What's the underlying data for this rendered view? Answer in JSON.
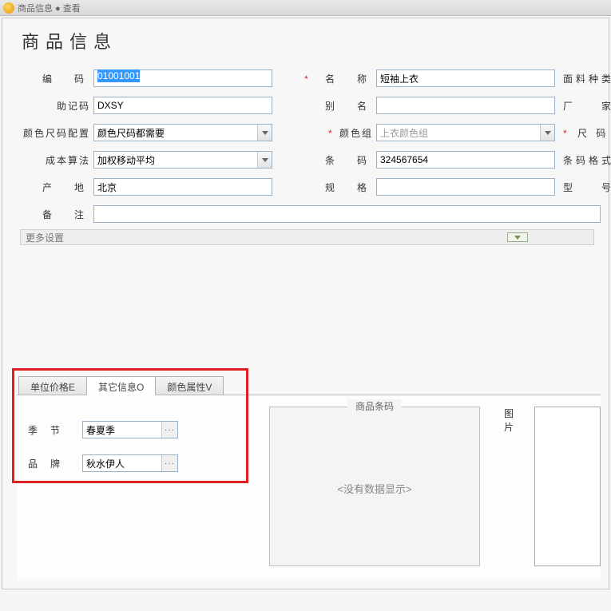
{
  "titlebar": {
    "text": "商品信息 ● 查看"
  },
  "page_title": "商品信息",
  "form": {
    "code": {
      "label": "编　码",
      "value": "01001001"
    },
    "mnemonic": {
      "label": "助记码",
      "value": "DXSY"
    },
    "colorsize": {
      "label": "颜色尺码配置",
      "value": "颜色尺码都需要"
    },
    "costmethod": {
      "label": "成本算法",
      "value": "加权移动平均"
    },
    "origin": {
      "label": "产　地",
      "value": "北京"
    },
    "remarks": {
      "label": "备　注",
      "value": ""
    },
    "name": {
      "label": "名　称",
      "value": "短袖上衣"
    },
    "alias": {
      "label": "别　名",
      "value": ""
    },
    "colorgroup": {
      "label": "颜色组",
      "value": "上衣颜色组"
    },
    "barcode": {
      "label": "条　码",
      "value": "324567654"
    },
    "spec": {
      "label": "规　格",
      "value": ""
    },
    "fabric": {
      "label": "面料种类"
    },
    "factory": {
      "label": "厂　　家"
    },
    "sizegroup": {
      "label": "尺 码 组"
    },
    "barcodefmt": {
      "label": "条码格式"
    },
    "model": {
      "label": "型　　号"
    }
  },
  "more_settings": "更多设置",
  "tabs": {
    "unitprice": "单位价格E",
    "otherinfo": "其它信息O",
    "colorattr": "颜色属性V"
  },
  "otherinfo": {
    "season": {
      "label": "季节",
      "value": "春夏季"
    },
    "brand": {
      "label": "品牌",
      "value": "秋水伊人"
    }
  },
  "barcode_group": {
    "title": "商品条码",
    "empty": "<没有数据显示>"
  },
  "image_group": {
    "label": "图片"
  },
  "required_mark": "*"
}
